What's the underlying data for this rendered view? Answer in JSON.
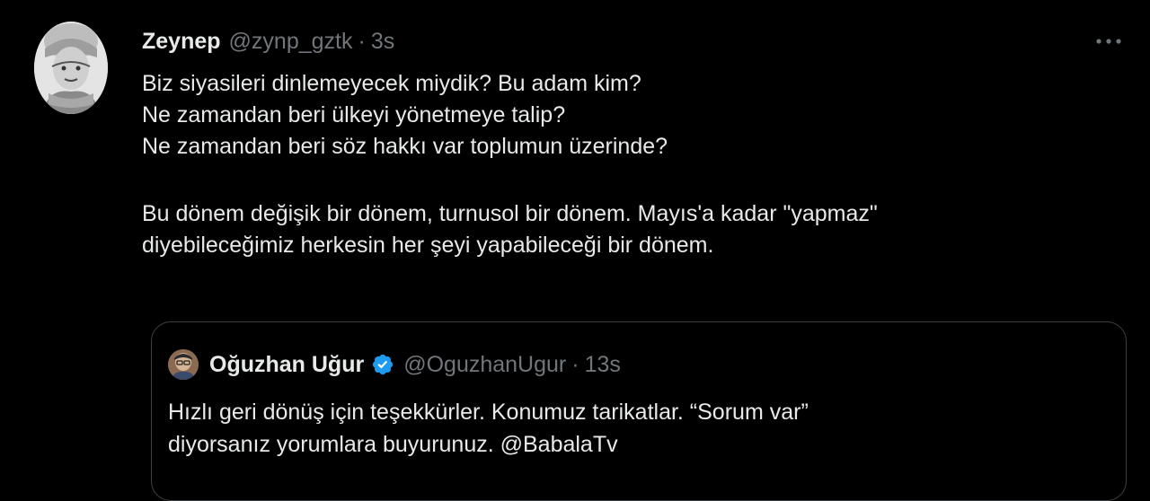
{
  "tweet": {
    "author_name": "Zeynep",
    "author_handle": "@zynp_gztk",
    "separator": "·",
    "time": "3s",
    "text_lines": [
      "Biz siyasileri dinlemeyecek miydik? Bu adam kim?",
      "Ne zamandan beri ülkeyi yönetmeye talip?",
      "Ne zamandan beri söz hakkı var toplumun üzerinde?",
      "Bu dönem değişik bir dönem, turnusol bir dönem. Mayıs'a kadar \"yapmaz\"",
      "diyebileceğimiz herkesin her şeyi yapabileceği bir dönem."
    ],
    "more_icon": "more-dots-icon"
  },
  "quoted_tweet": {
    "author_name": "Oğuzhan Uğur",
    "author_handle": "@OguzhanUgur",
    "separator": "·",
    "time": "13s",
    "verified_icon": "verified-badge-icon",
    "text_lines": [
      "Hızlı geri dönüş için teşekkürler. Konumuz tarikatlar. “Sorum var”",
      "diyorsanız yorumlara buyurunuz. @BabalaTv"
    ]
  },
  "colors": {
    "background": "#000000",
    "text_primary": "#e7e9ea",
    "text_secondary": "#71767b",
    "border": "#3e4144",
    "verified_blue": "#1d9bf0"
  }
}
